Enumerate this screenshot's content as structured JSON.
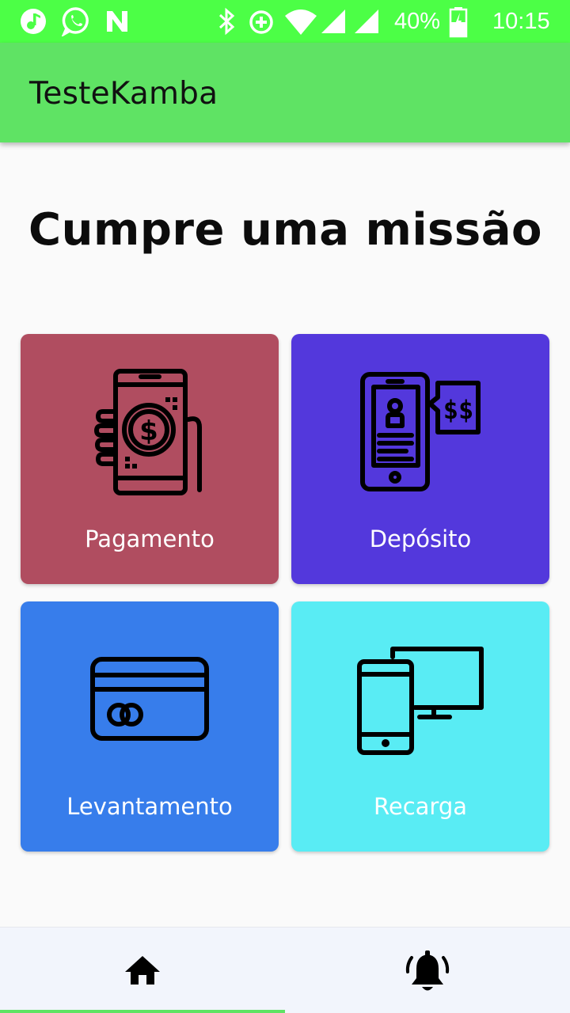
{
  "status_bar": {
    "battery": "40%",
    "time": "10:15",
    "icons": [
      "music-note-icon",
      "whatsapp-icon",
      "n-app-icon",
      "bluetooth-icon",
      "data-saver-icon",
      "wifi-icon",
      "signal-icon",
      "signal-icon",
      "battery-charging-icon"
    ]
  },
  "app_bar": {
    "title": "TesteKamba"
  },
  "main": {
    "heading": "Cumpre uma missão",
    "cards": [
      {
        "label": "Pagamento",
        "icon": "phone-payment-icon",
        "color": "#b04d60"
      },
      {
        "label": "Depósito",
        "icon": "phone-deposit-icon",
        "color": "#5338dc"
      },
      {
        "label": "Levantamento",
        "icon": "credit-card-icon",
        "color": "#377deb"
      },
      {
        "label": "Recarga",
        "icon": "devices-icon",
        "color": "#59ecf4"
      }
    ]
  },
  "bottom_nav": {
    "items": [
      {
        "icon": "home-icon",
        "selected": true
      },
      {
        "icon": "bell-icon",
        "selected": false
      }
    ],
    "indicator_color": "#5fe364"
  }
}
